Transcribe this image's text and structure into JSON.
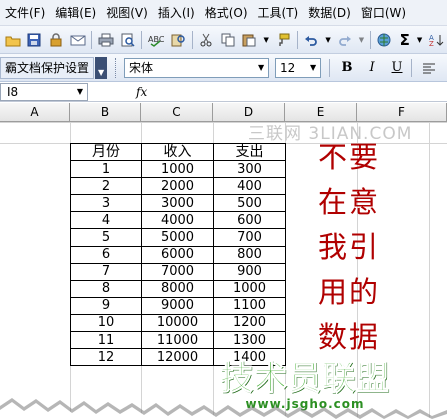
{
  "menubar": {
    "items": [
      "文件(F)",
      "编辑(E)",
      "视图(V)",
      "插入(I)",
      "格式(O)",
      "工具(T)",
      "数据(D)",
      "窗口(W)"
    ]
  },
  "toolbar": {
    "icons": [
      "open-icon",
      "save-icon",
      "permission-icon",
      "email-icon",
      "print-icon",
      "print-preview-icon",
      "spelling-icon",
      "research-icon",
      "cut-icon",
      "copy-icon",
      "paste-icon",
      "format-painter-icon",
      "undo-icon",
      "redo-icon",
      "hyperlink-icon",
      "autosum-icon"
    ],
    "autosum_symbol": "Σ"
  },
  "fmtbar": {
    "protect_label": "霸文档保护设置",
    "font_name": "宋体",
    "font_size": "12",
    "bold": "B",
    "italic": "I",
    "underline": "U"
  },
  "formulabar": {
    "name_box": "I8",
    "fx": "fx"
  },
  "columns": [
    "A",
    "B",
    "C",
    "D",
    "E",
    "F"
  ],
  "table": {
    "headers": [
      "月份",
      "收入",
      "支出"
    ],
    "rows": [
      [
        "1",
        "1000",
        "300"
      ],
      [
        "2",
        "2000",
        "400"
      ],
      [
        "3",
        "3000",
        "500"
      ],
      [
        "4",
        "4000",
        "600"
      ],
      [
        "5",
        "5000",
        "700"
      ],
      [
        "6",
        "6000",
        "800"
      ],
      [
        "7",
        "7000",
        "900"
      ],
      [
        "8",
        "8000",
        "1000"
      ],
      [
        "9",
        "9000",
        "1100"
      ],
      [
        "10",
        "10000",
        "1200"
      ],
      [
        "11",
        "11000",
        "1300"
      ],
      [
        "12",
        "12000",
        "1400"
      ]
    ]
  },
  "annotation": {
    "lines": [
      "不要",
      "在意",
      "我引",
      "用的",
      "数据"
    ],
    "color": "#b00000"
  },
  "watermark": "三联网 3LIAN.COM",
  "logo": {
    "name": "技术员联盟",
    "url": "www.jsgho.com",
    "color": "#3cab2c"
  }
}
